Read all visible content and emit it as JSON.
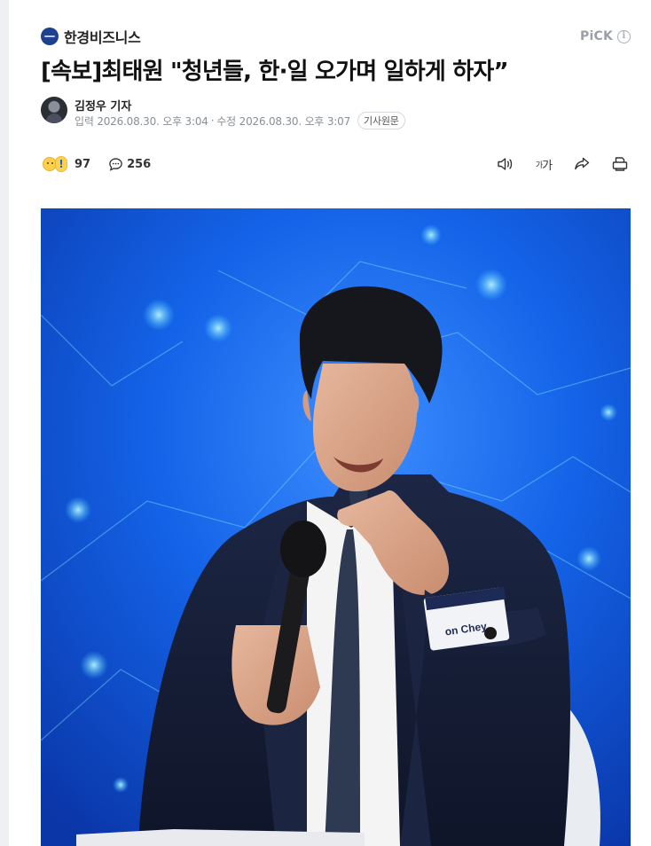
{
  "press": {
    "name": "한경비즈니스",
    "logo_icon": "press-logo-icon",
    "pick_label": "PiCK",
    "info_icon": "info-icon"
  },
  "article": {
    "headline": "[속보]최태원 \"청년들, 한·일 오가며 일하게 하자”",
    "reporter": "김정우 기자",
    "input_label": "입력",
    "input_time": "2026.08.30. 오후 3:04",
    "separator": "·",
    "modified_label": "수정",
    "modified_time": "2026.08.30. 오후 3:07",
    "original_link": "기사원문"
  },
  "actions": {
    "reaction_count": "97",
    "comment_count": "256",
    "font_size_label_small": "가",
    "font_size_label_large": "가",
    "icons": [
      "audio-icon",
      "font-size-icon",
      "share-icon",
      "print-icon"
    ]
  },
  "photo": {
    "name_tag_text": "on Chey",
    "colors": {
      "background": "#0a3fb8",
      "suit": "#141b33",
      "shirt": "#f2f2f2"
    }
  }
}
